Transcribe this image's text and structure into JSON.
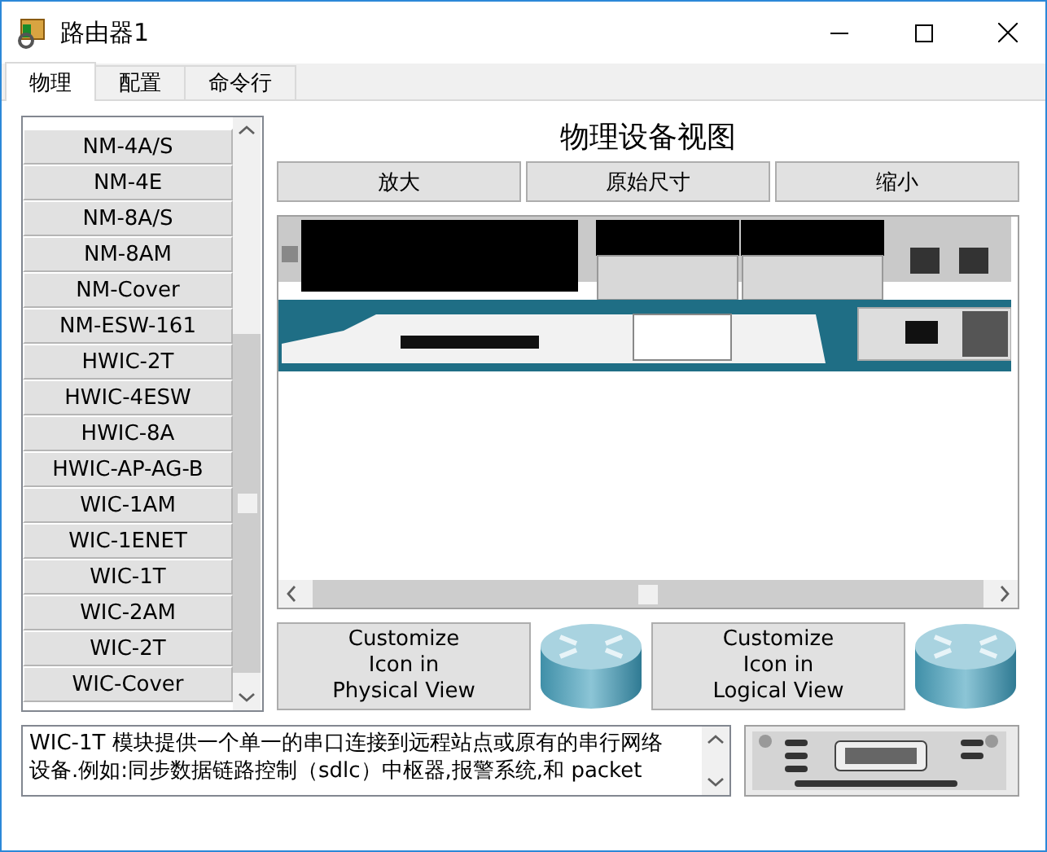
{
  "window": {
    "title": "路由器1"
  },
  "tabs": [
    {
      "label": "物理",
      "selected": true
    },
    {
      "label": "配置",
      "selected": false
    },
    {
      "label": "命令行",
      "selected": false
    }
  ],
  "modules": [
    "NM-4A/S",
    "NM-4E",
    "NM-8A/S",
    "NM-8AM",
    "NM-Cover",
    "NM-ESW-161",
    "HWIC-2T",
    "HWIC-4ESW",
    "HWIC-8A",
    "HWIC-AP-AG-B",
    "WIC-1AM",
    "WIC-1ENET",
    "WIC-1T",
    "WIC-2AM",
    "WIC-2T",
    "WIC-Cover"
  ],
  "view": {
    "title": "物理设备视图",
    "buttons": [
      "放大",
      "原始尺寸",
      "缩小"
    ]
  },
  "customize_buttons": [
    "Customize\nIcon in\nPhysical View",
    "Customize\nIcon in\nLogical View"
  ],
  "description": "WIC-1T 模块提供一个单一的串口连接到远程站点或原有的串行网络设备.例如:同步数据链路控制（sdlc）中枢器,报警系统,和 packet"
}
